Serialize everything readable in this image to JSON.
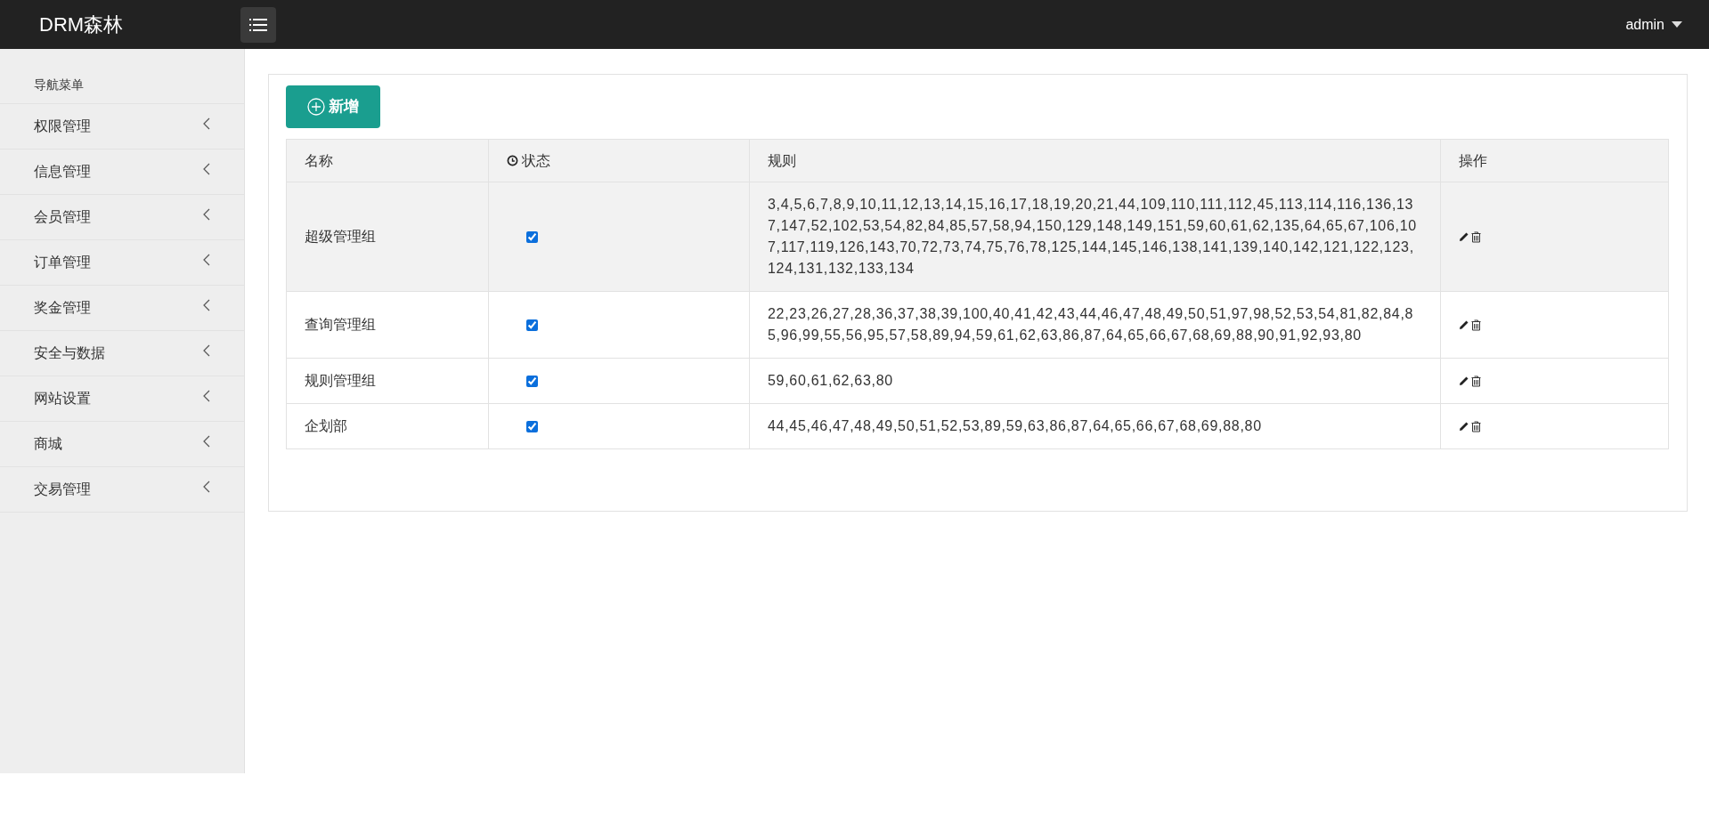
{
  "header": {
    "brand": "DRM森林",
    "user": "admin"
  },
  "sidebar": {
    "title": "导航菜单",
    "items": [
      {
        "label": "权限管理",
        "expanded": false
      },
      {
        "label": "信息管理",
        "expanded": false
      },
      {
        "label": "会员管理",
        "expanded": false
      },
      {
        "label": "订单管理",
        "expanded": false
      },
      {
        "label": "奖金管理",
        "expanded": false
      },
      {
        "label": "安全与数据",
        "expanded": false
      },
      {
        "label": "网站设置",
        "expanded": false
      },
      {
        "label": "商城",
        "expanded": false
      },
      {
        "label": "交易管理",
        "expanded": false
      }
    ]
  },
  "toolbar": {
    "add_button": "新增"
  },
  "table": {
    "columns": [
      "名称",
      "状态",
      "规则",
      "操作"
    ],
    "rows": [
      {
        "name": "超级管理组",
        "checked": true,
        "selected": true,
        "rules": "3,4,5,6,7,8,9,10,11,12,13,14,15,16,17,18,19,20,21,44,109,110,111,112,45,113,114,116,136,137,147,52,102,53,54,82,84,85,57,58,94,150,129,148,149,151,59,60,61,62,135,64,65,67,106,107,117,119,126,143,70,72,73,74,75,76,78,125,144,145,146,138,141,139,140,142,121,122,123,124,131,132,133,134"
      },
      {
        "name": "查询管理组",
        "checked": true,
        "selected": false,
        "rules": "22,23,26,27,28,36,37,38,39,100,40,41,42,43,44,46,47,48,49,50,51,97,98,52,53,54,81,82,84,85,96,99,55,56,95,57,58,89,94,59,61,62,63,86,87,64,65,66,67,68,69,88,90,91,92,93,80"
      },
      {
        "name": "规则管理组",
        "checked": true,
        "selected": false,
        "rules": "59,60,61,62,63,80"
      },
      {
        "name": "企划部",
        "checked": true,
        "selected": false,
        "rules": "44,45,46,47,48,49,50,51,52,53,89,59,63,86,87,64,65,66,67,68,69,88,80"
      }
    ]
  }
}
